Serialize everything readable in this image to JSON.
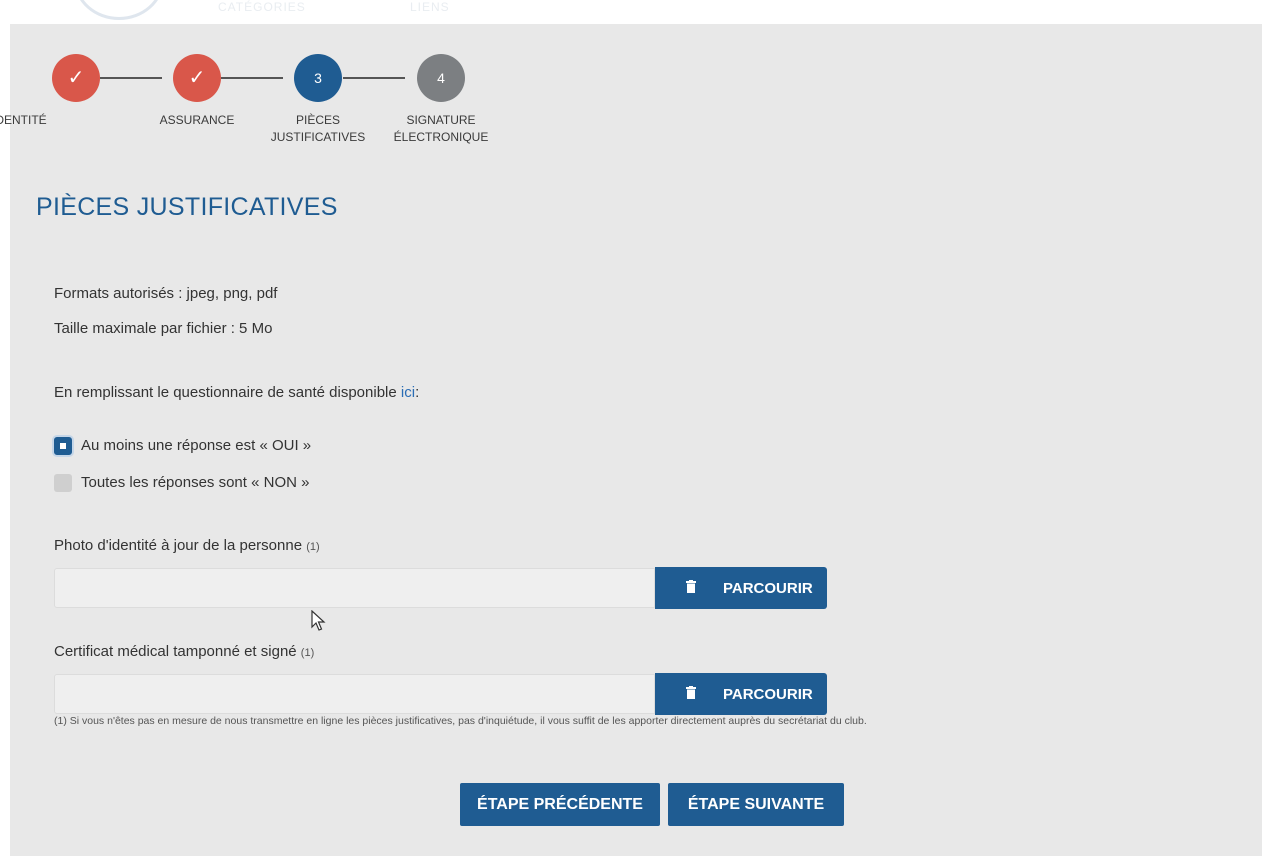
{
  "topbar": {
    "ghost_left": "CATÉGORIES",
    "ghost_right": "LIENS"
  },
  "stepper": {
    "steps": [
      {
        "label_line1": "IDENTITÉ",
        "label_line2": "",
        "state": "done",
        "marker": "✓"
      },
      {
        "label_line1": "ASSURANCE",
        "label_line2": "",
        "state": "done",
        "marker": "✓"
      },
      {
        "label_line1": "PIÈCES",
        "label_line2": "JUSTIFICATIVES",
        "state": "active",
        "marker": "3"
      },
      {
        "label_line1": "SIGNATURE",
        "label_line2": "ÉLECTRONIQUE",
        "state": "todo",
        "marker": "4"
      }
    ]
  },
  "section": {
    "title": "PIÈCES JUSTIFICATIVES",
    "formats": "Formats autorisés : jpeg, png, pdf",
    "max_size": "Taille maximale par fichier : 5 Mo",
    "questionnaire_text": "En remplissant le questionnaire de santé disponible ",
    "questionnaire_link": "ici",
    "questionnaire_suffix": ":"
  },
  "health_options": [
    {
      "label": "Au moins une réponse est « OUI »",
      "checked": true
    },
    {
      "label": "Toutes les réponses sont « NON »",
      "checked": false
    }
  ],
  "uploads": {
    "photo": {
      "label": "Photo d'identité à jour de la personne",
      "note": "(1)",
      "value": "",
      "button": "PARCOURIR"
    },
    "certificate": {
      "label": "Certificat médical tamponné et signé",
      "note": "(1)",
      "value": "",
      "button": "PARCOURIR"
    }
  },
  "footnote": "(1) Si vous n'êtes pas en mesure de nous transmettre en ligne les pièces justificatives, pas d'inquiétude, il vous suffit de les apporter directement auprès du secrétariat du club.",
  "navigation": {
    "previous": "ÉTAPE PRÉCÉDENTE",
    "next": "ÉTAPE SUIVANTE"
  },
  "icons": {
    "done_step": "check-icon",
    "browse": "trash-icon",
    "pointer": "mouse-cursor-icon"
  },
  "colors": {
    "primary": "#1f5c92",
    "done": "#d9574a",
    "todo": "#7c7f82",
    "panel": "#e8e8e8"
  }
}
